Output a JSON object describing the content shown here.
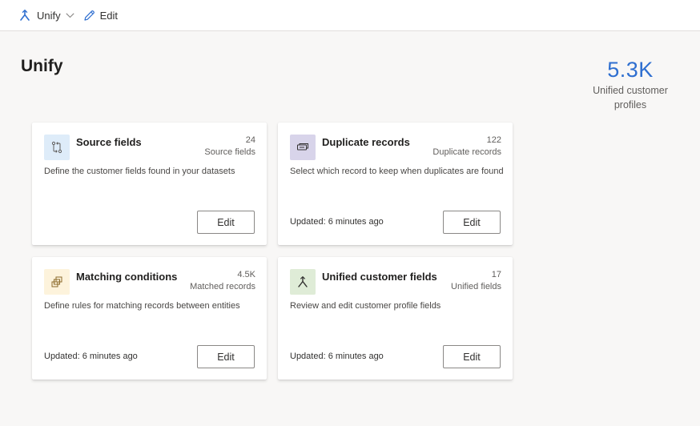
{
  "colors": {
    "accent": "#2f6fd0",
    "source_icon_bg": "#deecf9",
    "duplicate_icon_bg": "#d8d4ea",
    "matching_icon_bg": "#fdf3dc",
    "unified_icon_bg": "#dfecd7"
  },
  "toolbar": {
    "unify_label": "Unify",
    "unify_icon": "unify-icon",
    "chevron_icon": "chevron-down-icon",
    "edit_label": "Edit",
    "edit_icon": "pencil-icon"
  },
  "page": {
    "title": "Unify"
  },
  "summary": {
    "value": "5.3K",
    "label": "Unified customer profiles"
  },
  "cards": {
    "source": {
      "icon": "source-fields-icon",
      "title": "Source fields",
      "count": "24",
      "count_label": "Source fields",
      "description": "Define the customer fields found in your datasets",
      "updated": "",
      "button": "Edit"
    },
    "duplicate": {
      "icon": "duplicate-records-icon",
      "title": "Duplicate records",
      "count": "122",
      "count_label": "Duplicate records",
      "description": "Select which record to keep when duplicates are found",
      "updated": "Updated: 6 minutes ago",
      "button": "Edit"
    },
    "matching": {
      "icon": "matching-conditions-icon",
      "title": "Matching conditions",
      "count": "4.5K",
      "count_label": "Matched records",
      "description": "Define rules for matching records between entities",
      "updated": "Updated: 6 minutes ago",
      "button": "Edit"
    },
    "unified": {
      "icon": "unified-fields-icon",
      "title": "Unified customer fields",
      "count": "17",
      "count_label": "Unified fields",
      "description": "Review and edit customer profile fields",
      "updated": "Updated: 6 minutes ago",
      "button": "Edit"
    }
  }
}
